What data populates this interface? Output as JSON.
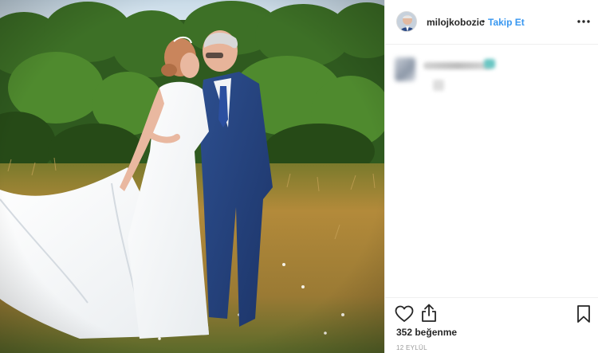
{
  "post": {
    "username": "milojkobozic",
    "separator": "•",
    "follow_label": "Takip Et",
    "likes_text": "352 beğenme",
    "date_text": "12 EYLÜL"
  },
  "icons": {
    "more": "more-options-icon",
    "like": "heart-icon",
    "share": "share-icon",
    "save": "bookmark-icon"
  },
  "colors": {
    "follow_blue": "#3897f0",
    "text_dark": "#262626",
    "muted": "#999999",
    "border": "#efefef"
  }
}
